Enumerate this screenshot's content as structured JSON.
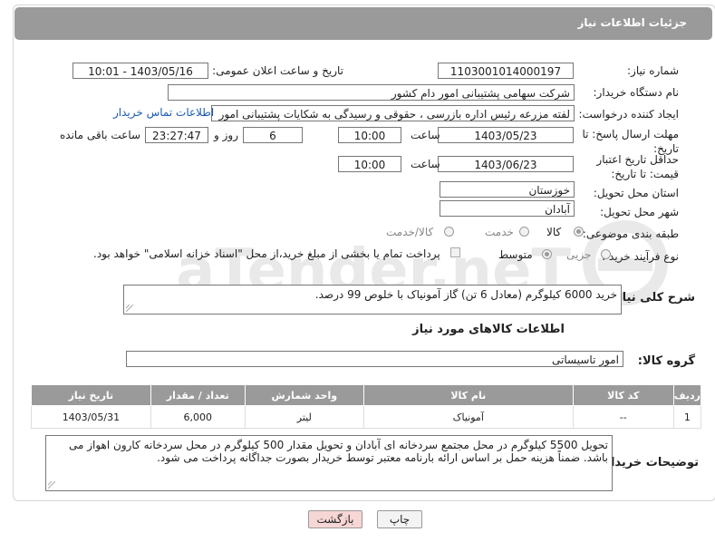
{
  "header": {
    "title": "جزئیات اطلاعات نیاز"
  },
  "fields": {
    "need_number_label": "شماره نیاز:",
    "need_number": "1103001014000197",
    "announce_label": "تاریخ و ساعت اعلان عمومی:",
    "announce_value": "1403/05/16 - 10:01",
    "buyer_label": "نام دستگاه خریدار:",
    "buyer_value": "شرکت سهامی پشتیبانی امور دام کشور",
    "requester_label": "ایجاد کننده درخواست:",
    "requester_value": "لفته مزرعه رئیس اداره بازرسی ، حقوقی و رسیدگی به شکایات  پشتیبانی امور",
    "contact_link": "اطلاعات تماس خریدار",
    "reply_deadline_label": "مهلت ارسال پاسخ: تا تاریخ:",
    "reply_date": "1403/05/23",
    "time_label": "ساعت",
    "reply_time": "10:00",
    "days_value": "6",
    "days_label": "روز و",
    "remaining_time": "23:27:47",
    "remaining_label": "ساعت باقی مانده",
    "validity_label": "حداقل تاریخ اعتبار قیمت: تا تاریخ:",
    "validity_date": "1403/06/23",
    "validity_time": "10:00",
    "province_label": "استان محل تحویل:",
    "province_value": "خوزستان",
    "city_label": "شهر محل تحویل:",
    "city_value": "آبادان",
    "category_label": "طبقه بندی موضوعی:",
    "category_options": [
      "کالا",
      "خدمت",
      "کالا/خدمت"
    ],
    "process_label": "نوع فرآیند خرید :",
    "process_options": [
      "جزیی",
      "متوسط"
    ],
    "payment_note": "پرداخت تمام یا بخشی از مبلغ خرید،از محل \"اسناد خزانه اسلامی\" خواهد بود."
  },
  "summary": {
    "label": "شرح کلی نیاز:",
    "text": "خرید 6000 کیلوگرم (معادل 6 تن) گاز آمونیاک با خلوص 99 درصد."
  },
  "goods_section": {
    "title": "اطلاعات کالاهای مورد نیاز",
    "group_label": "گروه کالا:",
    "group_value": "امور تاسیساتی"
  },
  "table": {
    "headers": [
      "ردیف",
      "کد کالا",
      "نام کالا",
      "واحد شمارش",
      "تعداد / مقدار",
      "تاریخ نیاز"
    ],
    "rows": [
      [
        "1",
        "--",
        "آمونیاک",
        "لیتر",
        "6,000",
        "1403/05/31"
      ]
    ]
  },
  "buyer_notes": {
    "label": "توضیحات خریدار:",
    "text": "تحویل 5500 کیلوگرم در محل مجتمع سردخانه ای آبادان و تحویل مقدار 500 کیلوگرم در محل سردخانه کارون اهواز می باشد. ضمناً هزینه حمل بر اساس ارائه بارنامه معتبر توسط خریدار بصورت جداگانه پرداخت می شود."
  },
  "buttons": {
    "print": "چاپ",
    "back": "بازگشت"
  },
  "watermark": "AriaTender.neT",
  "colors": {
    "header_bg": "#9a9a9a",
    "link": "#1a5bb5",
    "back_btn_bg": "#f7d6d6"
  }
}
